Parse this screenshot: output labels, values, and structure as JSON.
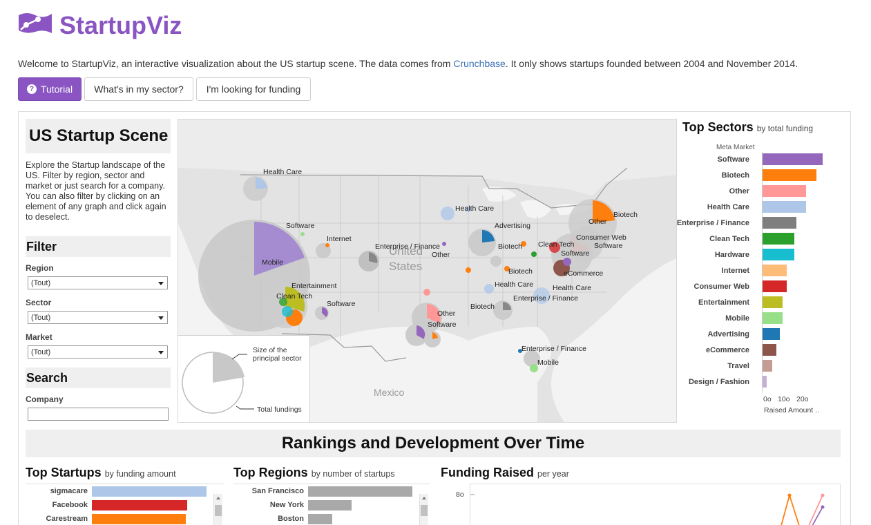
{
  "header": {
    "brand": "StartupViz",
    "intro_before": "Welcome to StartupViz, an interactive visualization about the US startup scene. The data comes from ",
    "intro_link": "Crunchbase",
    "intro_after": ". It only shows startups founded between 2004 and November 2014.",
    "buttons": {
      "tutorial": "Tutorial",
      "sector": "What's in my sector?",
      "funding": "I'm looking for funding"
    },
    "colors": {
      "brand": "#8a55c2",
      "link": "#3a70b4"
    }
  },
  "left": {
    "title": "US Startup Scene",
    "description": "Explore the Startup landscape of the US. Filter by region, sector and market or just search for a company. You can also filter by clicking on an element of any graph and click again to deselect.",
    "filter_heading": "Filter",
    "region_label": "Region",
    "region_value": "(Tout)",
    "sector_label": "Sector",
    "sector_value": "(Tout)",
    "market_label": "Market",
    "market_value": "(Tout)",
    "search_heading": "Search",
    "company_label": "Company",
    "company_value": ""
  },
  "map": {
    "country_label_1": "United",
    "country_label_2": "States",
    "mexico_label": "Mexico",
    "labels": [
      "Health Care",
      "Software",
      "Internet",
      "Mobile",
      "Entertainment",
      "Clean Tech",
      "Software",
      "Health Care",
      "Advertising",
      "Enterprise / Finance",
      "Other",
      "Biotech",
      "Clean Tech",
      "Software",
      "Other",
      "Biotech",
      "Consumer Web",
      "Software",
      "eCommerce",
      "Biotech",
      "Health Care",
      "Health Care",
      "Enterprise / Finance",
      "Biotech",
      "Other",
      "Software",
      "Enterprise / Finance",
      "Mobile"
    ],
    "legend": {
      "principal": "Size of the principal sector",
      "total": "Total fundings"
    }
  },
  "top_sectors": {
    "title": "Top Sectors",
    "subtitle": "by total funding",
    "meta_label": "Meta Market",
    "axis_ticks": [
      "0o",
      "10o",
      "20o"
    ],
    "axis_label": "Raised Amount ..",
    "items": [
      {
        "label": "Software",
        "value": 28.5,
        "color": "#9467bd"
      },
      {
        "label": "Biotech",
        "value": 25.5,
        "color": "#ff7f0e"
      },
      {
        "label": "Other",
        "value": 20.5,
        "color": "#ff9896"
      },
      {
        "label": "Health Care",
        "value": 20.5,
        "color": "#aec7e8"
      },
      {
        "label": "Enterprise / Finance",
        "value": 16.0,
        "color": "#7f7f7f"
      },
      {
        "label": "Clean Tech",
        "value": 15.0,
        "color": "#2ca02c"
      },
      {
        "label": "Hardware",
        "value": 15.0,
        "color": "#17becf"
      },
      {
        "label": "Internet",
        "value": 11.5,
        "color": "#ffbb78"
      },
      {
        "label": "Consumer Web",
        "value": 11.5,
        "color": "#d62728"
      },
      {
        "label": "Entertainment",
        "value": 9.5,
        "color": "#bcbd22"
      },
      {
        "label": "Mobile",
        "value": 9.5,
        "color": "#98df8a"
      },
      {
        "label": "Advertising",
        "value": 8.0,
        "color": "#1f77b4"
      },
      {
        "label": "eCommerce",
        "value": 6.5,
        "color": "#8c564b"
      },
      {
        "label": "Travel",
        "value": 4.5,
        "color": "#c49c94"
      },
      {
        "label": "Design / Fashion",
        "value": 2.0,
        "color": "#c5b0d5"
      }
    ]
  },
  "rankings": {
    "banner": "Rankings and Development Over Time",
    "top_startups": {
      "title": "Top Startups",
      "subtitle": "by funding amount",
      "items": [
        {
          "label": "sigmacare",
          "value": 100,
          "color": "#aec7e8"
        },
        {
          "label": "Facebook",
          "value": 83,
          "color": "#d62728"
        },
        {
          "label": "Carestream",
          "value": 82,
          "color": "#ff7f0e"
        }
      ]
    },
    "top_regions": {
      "title": "Top Regions",
      "subtitle": "by number of startups",
      "items": [
        {
          "label": "San Francisco",
          "value": 100,
          "color": "#a9a9a9"
        },
        {
          "label": "New York",
          "value": 42,
          "color": "#a9a9a9"
        },
        {
          "label": "Boston",
          "value": 23,
          "color": "#a9a9a9"
        }
      ]
    },
    "funding_raised": {
      "title": "Funding Raised",
      "subtitle": "per year",
      "y_tick": "8o"
    }
  }
}
